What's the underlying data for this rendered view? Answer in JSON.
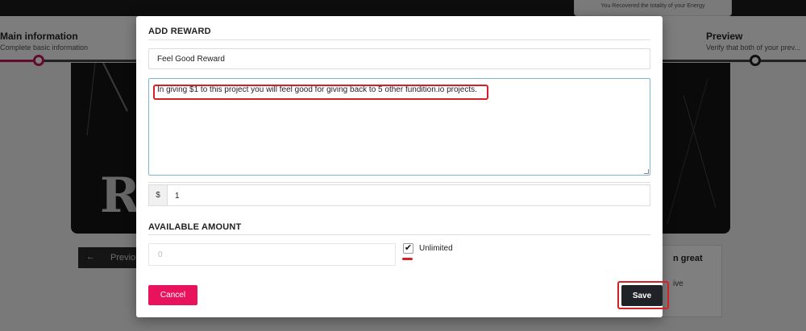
{
  "background": {
    "toast_text": "You Recovered the totality of your Energy",
    "steps": [
      {
        "title": "Main information",
        "subtitle": "Complete basic information"
      },
      {
        "title": "Preview",
        "subtitle": "Verify that both of your prev..."
      }
    ],
    "image_text": "R",
    "previous_button": "Previous",
    "card_title": "n great",
    "card_subtitle": "ive"
  },
  "modal": {
    "title": "ADD REWARD",
    "reward_name": "Feel Good Reward",
    "reward_description": "In giving $1 to this project  you will feel good for giving back to 5 other fundition.io projects.",
    "price_prefix": "$",
    "price_value": "1",
    "available_amount_title": "AVAILABLE AMOUNT",
    "amount_placeholder": "0",
    "unlimited_label": "Unlimited",
    "unlimited_checked": true,
    "cancel_label": "Cancel",
    "save_label": "Save"
  },
  "colors": {
    "accent_pink": "#e8135c",
    "save_dark": "#1f2227",
    "highlight_red": "#d62028",
    "focus_blue": "#7fb6d6"
  }
}
